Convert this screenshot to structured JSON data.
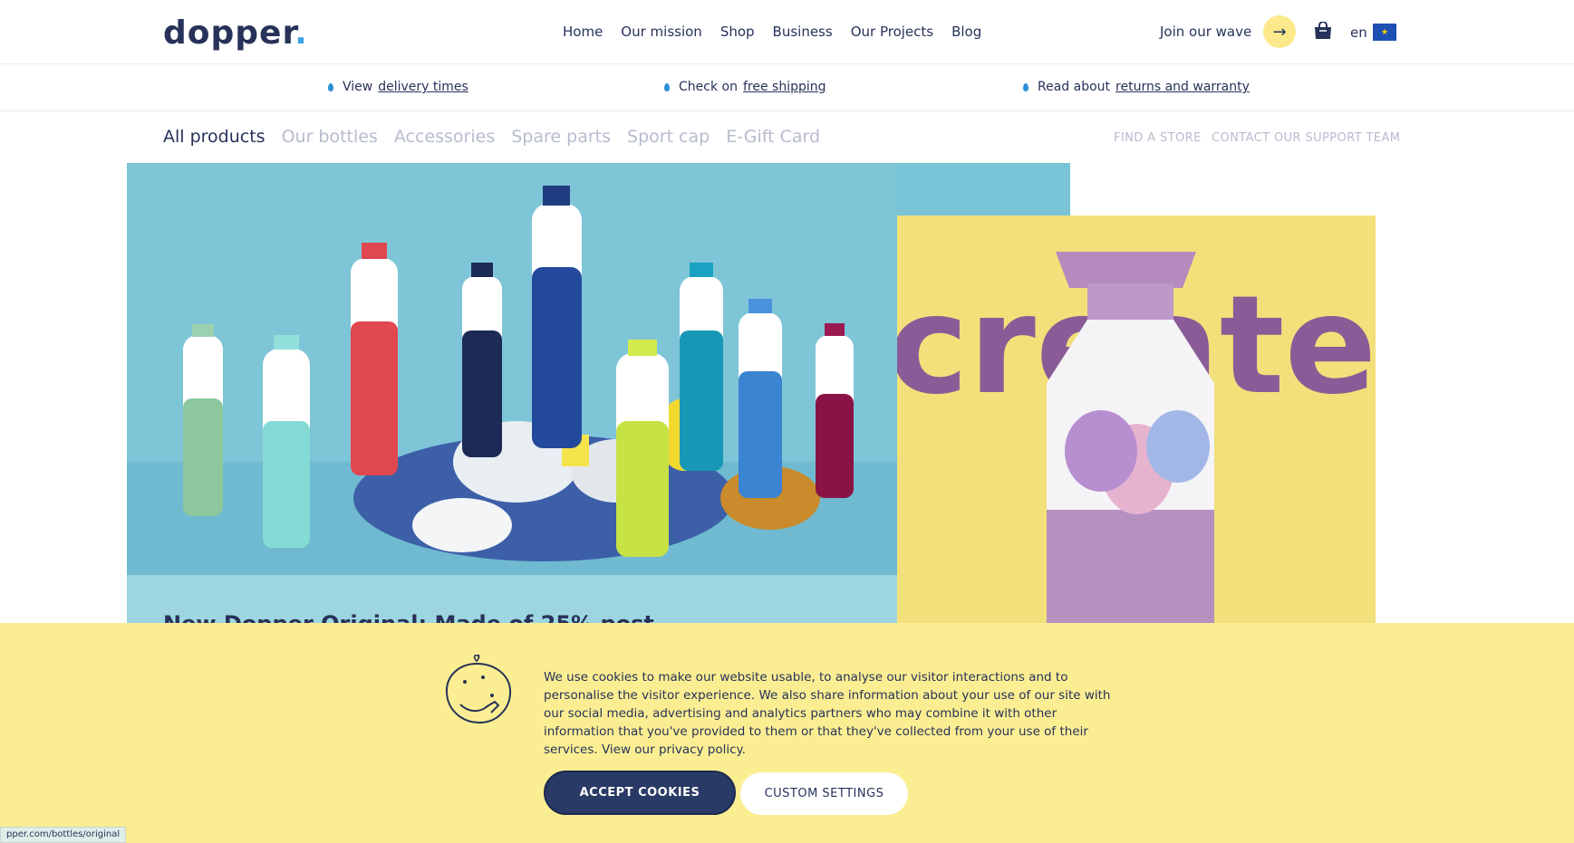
{
  "header": {
    "logo_text": "dopper",
    "nav": [
      "Home",
      "Our mission",
      "Shop",
      "Business",
      "Our Projects",
      "Blog"
    ],
    "join_label": "Join our wave",
    "lang": "en"
  },
  "infobar": {
    "items": [
      {
        "prefix": "View",
        "link": "delivery times"
      },
      {
        "prefix": "Check on",
        "link": "free shipping"
      },
      {
        "prefix": "Read about",
        "link": "returns and warranty"
      }
    ]
  },
  "categories": {
    "tabs": [
      "All products",
      "Our bottles",
      "Accessories",
      "Spare parts",
      "Sport cap",
      "E-Gift Card"
    ],
    "active": "All products",
    "find_store": "FIND A STORE",
    "contact": "CONTACT OUR SUPPORT TEAM"
  },
  "hero": {
    "title": "New Dopper Original: Made of 25% post",
    "create_word": "create"
  },
  "cookie": {
    "text": "We use cookies to make our website usable, to analyse our visitor interactions and to personalise the visitor experience. We also share information about your use of our site with our social media, advertising and analytics partners who may combine it with other information that you've provided to them or that they've collected from your use of their services. View our privacy policy.",
    "accept_label": "ACCEPT COOKIES",
    "custom_label": "CUSTOM SETTINGS"
  },
  "status_url": "pper.com/bottles/original",
  "colors": {
    "navy": "#27325a",
    "cookie_bg": "#fbee92",
    "hero_blue": "#79c4d6",
    "create_yellow": "#f2e07a",
    "create_purple": "#8a5c97"
  }
}
